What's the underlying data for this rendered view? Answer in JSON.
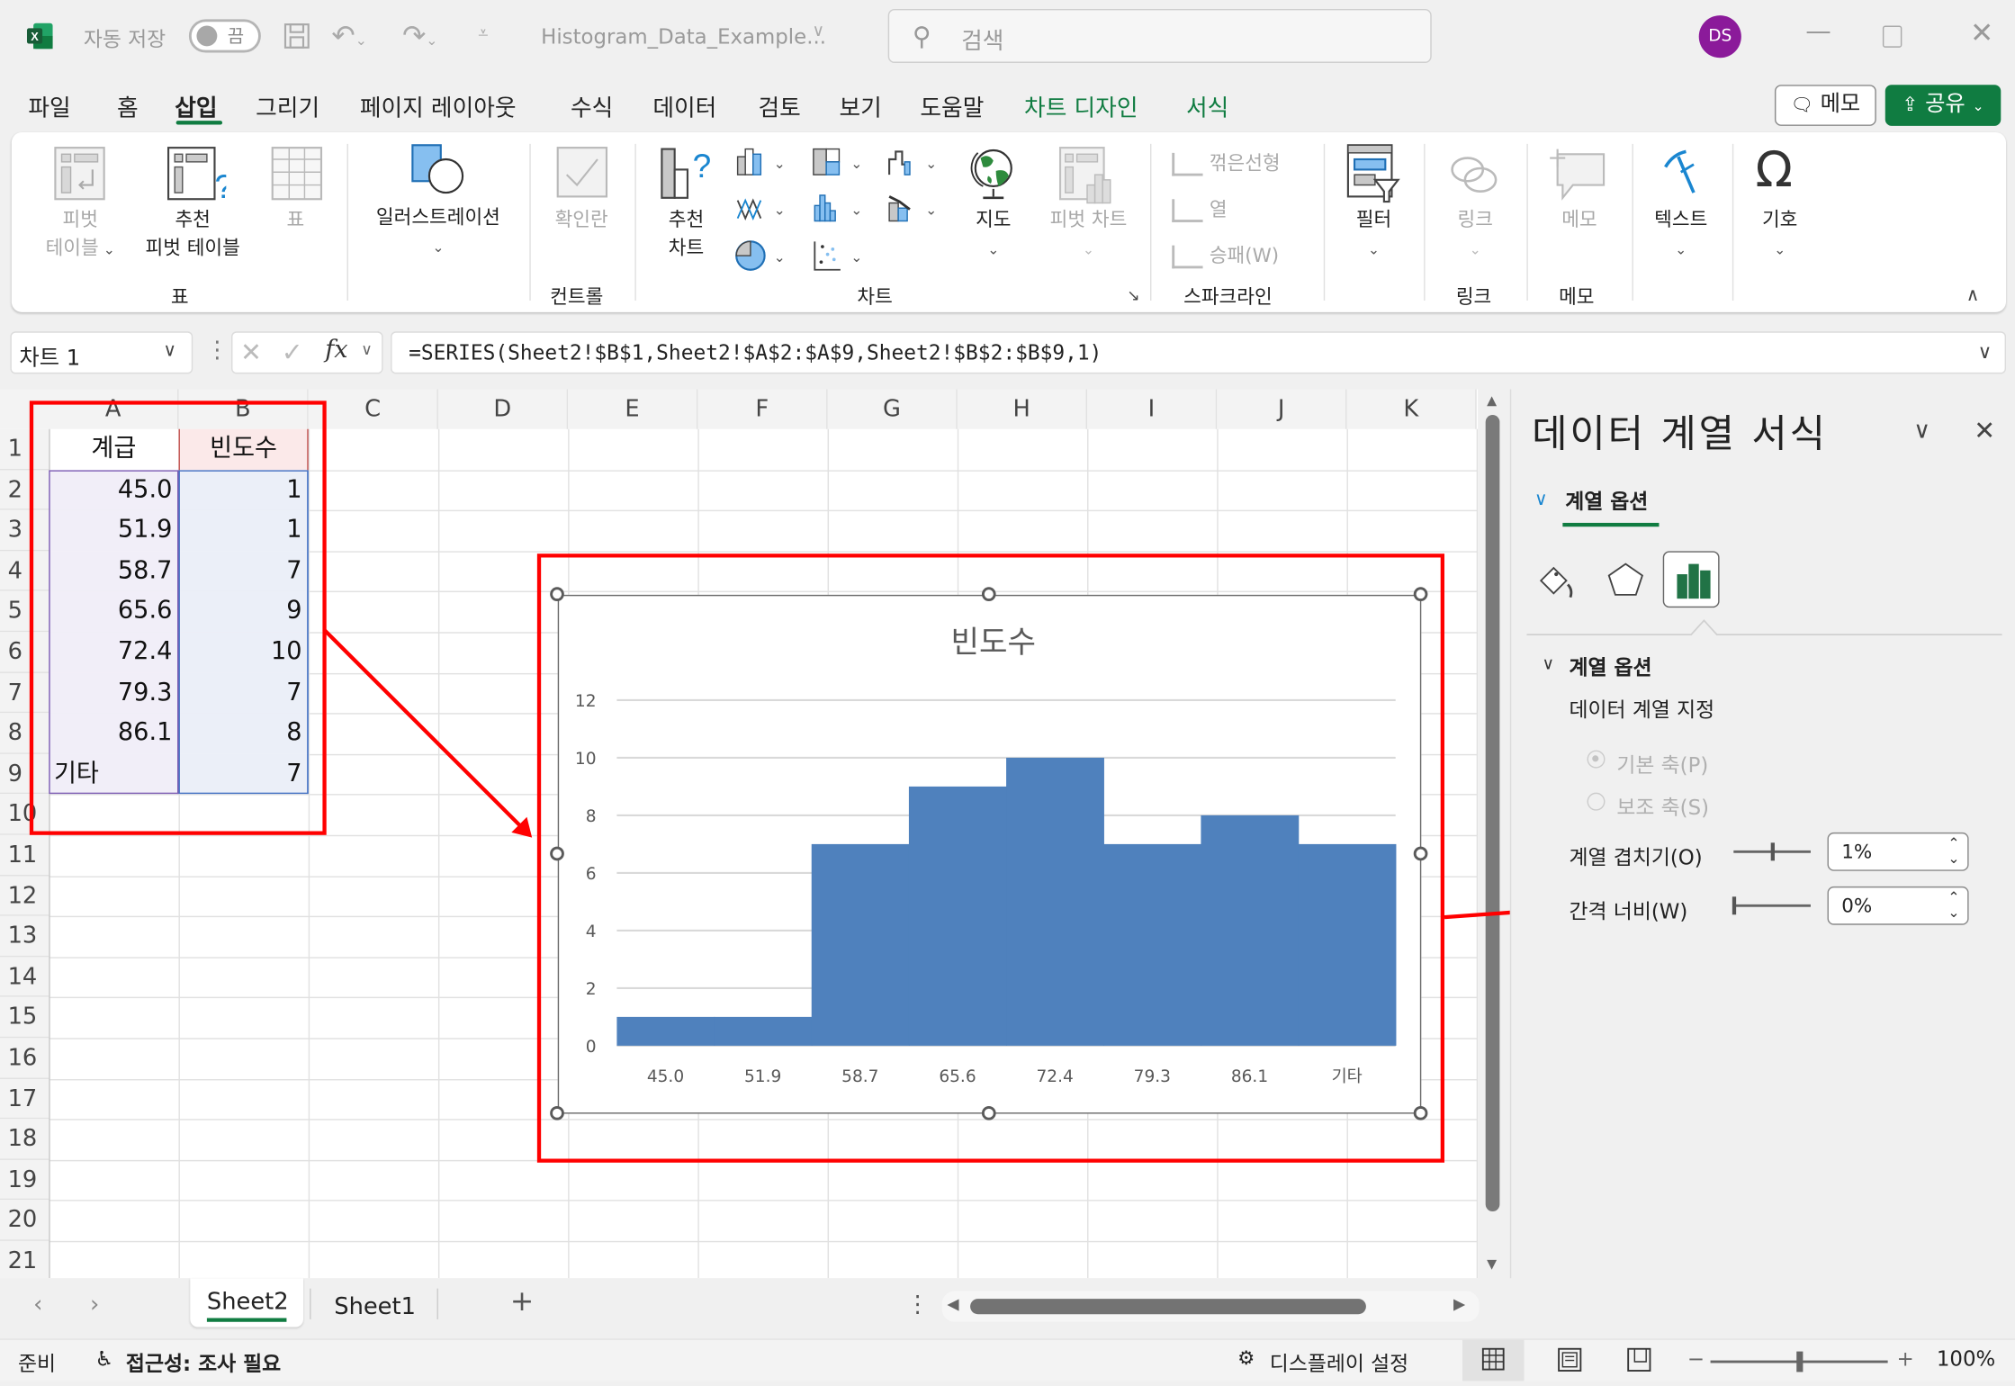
{
  "titlebar": {
    "app_icon": "excel-icon",
    "autosave_label": "자동 저장",
    "autosave_state": "끔",
    "filename": "Histogram_Data_Example...",
    "search_placeholder": "검색",
    "user_initials": "DS"
  },
  "menu": {
    "tabs": [
      {
        "label": "파일"
      },
      {
        "label": "홈"
      },
      {
        "label": "삽입",
        "active": true
      },
      {
        "label": "그리기"
      },
      {
        "label": "페이지 레이아웃"
      },
      {
        "label": "수식"
      },
      {
        "label": "데이터"
      },
      {
        "label": "검토"
      },
      {
        "label": "보기"
      },
      {
        "label": "도움말"
      },
      {
        "label": "차트 디자인",
        "contextual": true
      },
      {
        "label": "서식",
        "contextual": true
      }
    ],
    "memo_button": "메모",
    "share_button": "공유"
  },
  "ribbon": {
    "pivot_table": "피벗\n테이블",
    "pivot_table_l1": "피벗",
    "pivot_table_l2": "테이블",
    "recommended_pivot_l1": "추천",
    "recommended_pivot_l2": "피벗 테이블",
    "table": "표",
    "illustrations": "일러스트레이션",
    "checkbox": "확인란",
    "recommended_chart_l1": "추천",
    "recommended_chart_l2": "차트",
    "maps": "지도",
    "pivot_chart": "피벗 차트",
    "sparkline_line": "꺾은선형",
    "sparkline_column": "열",
    "sparkline_winloss": "승패(W)",
    "filter": "필터",
    "link": "링크",
    "comment": "메모",
    "text": "텍스트",
    "symbol": "기호",
    "groups": {
      "tables": "표",
      "controls": "컨트롤",
      "charts": "차트",
      "sparklines": "스파크라인",
      "links": "링크",
      "comments": "메모"
    }
  },
  "formula_bar": {
    "name_box": "차트 1",
    "formula": "=SERIES(Sheet2!$B$1,Sheet2!$A$2:$A$9,Sheet2!$B$2:$B$9,1)"
  },
  "grid": {
    "columns": [
      "A",
      "B",
      "C",
      "D",
      "E",
      "F",
      "G",
      "H",
      "I",
      "J",
      "K"
    ],
    "rows": [
      "1",
      "2",
      "3",
      "4",
      "5",
      "6",
      "7",
      "8",
      "9",
      "10",
      "11",
      "12",
      "13",
      "14",
      "15",
      "16",
      "17",
      "18",
      "19",
      "20",
      "21"
    ],
    "header": {
      "A": "계급",
      "B": "빈도수"
    },
    "data": [
      {
        "A": "45.0",
        "B": "1"
      },
      {
        "A": "51.9",
        "B": "1"
      },
      {
        "A": "58.7",
        "B": "7"
      },
      {
        "A": "65.6",
        "B": "9"
      },
      {
        "A": "72.4",
        "B": "10"
      },
      {
        "A": "79.3",
        "B": "7"
      },
      {
        "A": "86.1",
        "B": "8"
      },
      {
        "A": "기타",
        "B": "7"
      }
    ]
  },
  "chart_data": {
    "type": "bar",
    "title": "빈도수",
    "categories": [
      "45.0",
      "51.9",
      "58.7",
      "65.6",
      "72.4",
      "79.3",
      "86.1",
      "기타"
    ],
    "values": [
      1,
      1,
      7,
      9,
      10,
      7,
      8,
      7
    ],
    "xlabel": "",
    "ylabel": "",
    "ylim": [
      0,
      12
    ],
    "yticks": [
      "0",
      "2",
      "4",
      "6",
      "8",
      "10",
      "12"
    ],
    "grid": true,
    "gap_width_percent": 0,
    "bar_color": "#4f81bd"
  },
  "format_pane": {
    "title": "데이터 계열 서식",
    "section_tab": "계열 옵션",
    "subsection": "계열 옵션",
    "plot_on_label": "데이터 계열 지정",
    "primary_axis": "기본 축(P)",
    "secondary_axis": "보조 축(S)",
    "overlap_label": "계열 겹치기(O)",
    "overlap_value": "1%",
    "overlap_fraction": 0.505,
    "gap_label": "간격 너비(W)",
    "gap_value": "0%",
    "gap_fraction": 0
  },
  "sheets": {
    "tabs": [
      {
        "label": "Sheet2",
        "active": true
      },
      {
        "label": "Sheet1"
      }
    ],
    "add": "+"
  },
  "status": {
    "ready": "준비",
    "accessibility": "접근성: 조사 필요",
    "display_settings": "디스플레이 설정",
    "zoom": "100%"
  },
  "colors": {
    "accent": "#107c41",
    "annotation": "#ff0000",
    "avatar": "#8b1a9a"
  }
}
